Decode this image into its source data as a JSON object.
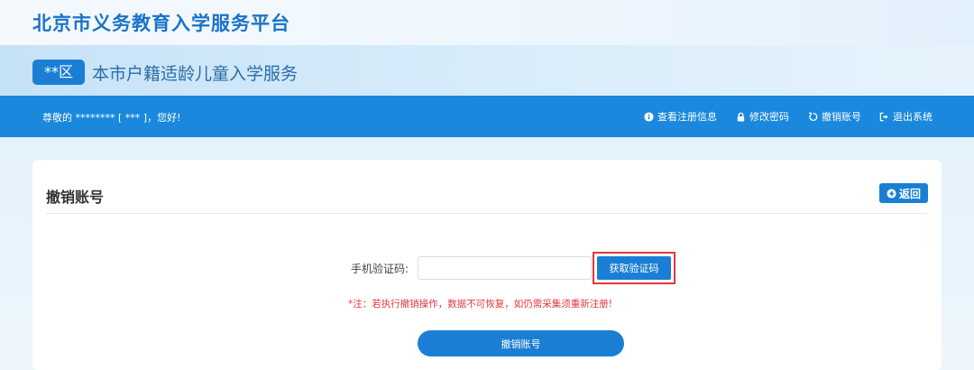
{
  "header": {
    "platform_title": "北京市义务教育入学服务平台",
    "district_badge": "**区",
    "service_title": "本市户籍适龄儿童入学服务"
  },
  "navbar": {
    "greeting": "尊敬的 ******** [ *** ]，您好!",
    "items": [
      {
        "label": "查看注册信息",
        "icon": "info-icon"
      },
      {
        "label": "修改密码",
        "icon": "lock-icon"
      },
      {
        "label": "撤销账号",
        "icon": "undo-icon"
      },
      {
        "label": "退出系统",
        "icon": "logout-icon"
      }
    ]
  },
  "card": {
    "title": "撤销账号",
    "back_label": "返回",
    "field_label": "手机验证码:",
    "input_value": "",
    "input_placeholder": "",
    "get_code_label": "获取验证码",
    "warning": "*注：若执行撤销操作，数据不可恢复，如仍需采集须重新注册!",
    "submit_label": "撤销账号"
  },
  "colors": {
    "brand_blue": "#1a88dc",
    "button_blue": "#1a7fd4",
    "warning_red": "#e0383e",
    "title_blue": "#1a73c8"
  }
}
